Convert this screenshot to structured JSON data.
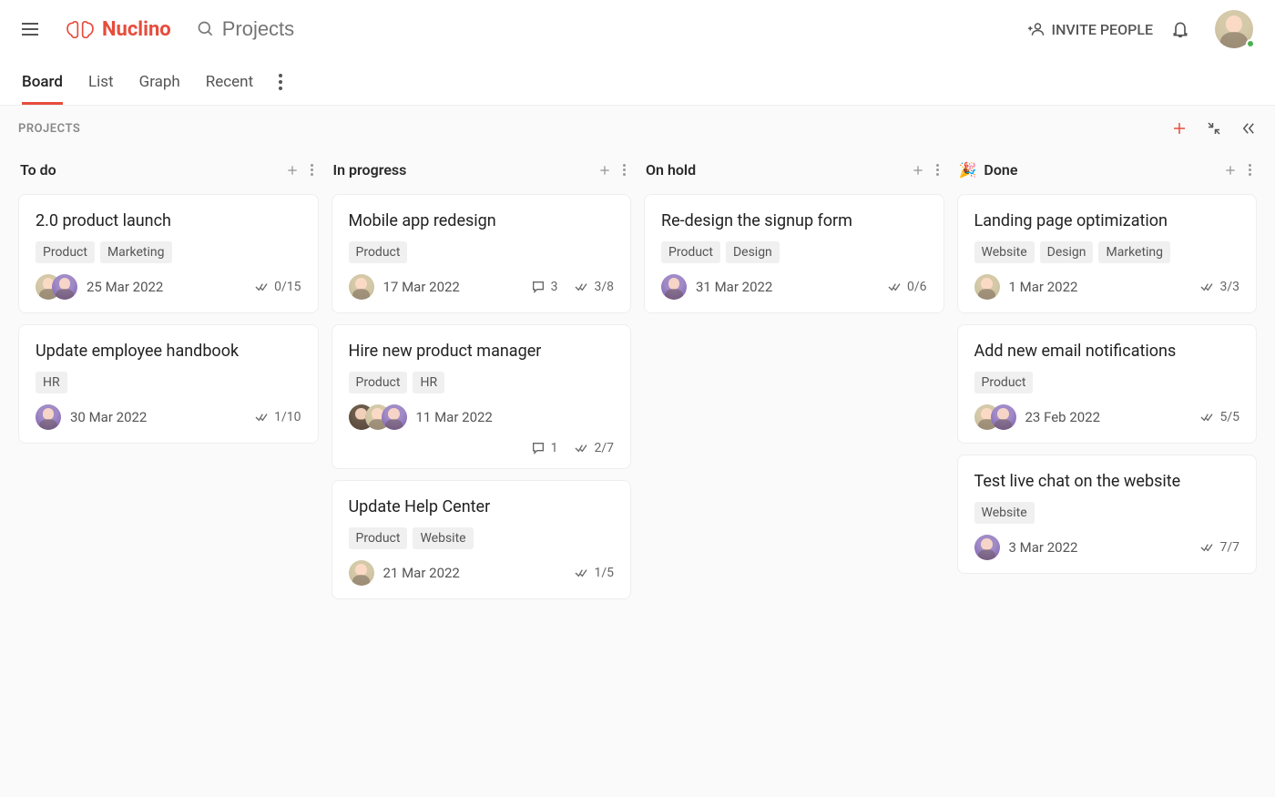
{
  "header": {
    "brand": "Nuclino",
    "search_placeholder": "Projects",
    "invite_label": "INVITE PEOPLE"
  },
  "tabs": {
    "board": "Board",
    "list": "List",
    "graph": "Graph",
    "recent": "Recent"
  },
  "crumb": "PROJECTS",
  "columns": [
    {
      "title": "To do",
      "emoji": "",
      "cards": [
        {
          "title": "2.0 product launch",
          "tags": [
            "Product",
            "Marketing"
          ],
          "avatars": [
            "beige",
            "purple"
          ],
          "date": "25 Mar 2022",
          "comments": null,
          "check": "0/15"
        },
        {
          "title": "Update employee handbook",
          "tags": [
            "HR"
          ],
          "avatars": [
            "purple"
          ],
          "date": "30 Mar 2022",
          "comments": null,
          "check": "1/10"
        }
      ]
    },
    {
      "title": "In progress",
      "emoji": "",
      "cards": [
        {
          "title": "Mobile app redesign",
          "tags": [
            "Product"
          ],
          "avatars": [
            "beige"
          ],
          "date": "17 Mar 2022",
          "comments": "3",
          "check": "3/8"
        },
        {
          "title": "Hire new product manager",
          "tags": [
            "Product",
            "HR"
          ],
          "avatars": [
            "dark",
            "beige",
            "purple"
          ],
          "date": "11 Mar 2022",
          "comments": "1",
          "check": "2/7"
        },
        {
          "title": "Update Help Center",
          "tags": [
            "Product",
            "Website"
          ],
          "avatars": [
            "beige"
          ],
          "date": "21 Mar 2022",
          "comments": null,
          "check": "1/5"
        }
      ]
    },
    {
      "title": "On hold",
      "emoji": "",
      "cards": [
        {
          "title": "Re-design the signup form",
          "tags": [
            "Product",
            "Design"
          ],
          "avatars": [
            "purple"
          ],
          "date": "31 Mar 2022",
          "comments": null,
          "check": "0/6"
        }
      ]
    },
    {
      "title": "Done",
      "emoji": "🎉",
      "cards": [
        {
          "title": "Landing page optimization",
          "tags": [
            "Website",
            "Design",
            "Marketing"
          ],
          "avatars": [
            "beige"
          ],
          "date": "1 Mar 2022",
          "comments": null,
          "check": "3/3"
        },
        {
          "title": "Add new email notifications",
          "tags": [
            "Product"
          ],
          "avatars": [
            "beige",
            "purple"
          ],
          "date": "23 Feb 2022",
          "comments": null,
          "check": "5/5"
        },
        {
          "title": "Test live chat on the website",
          "tags": [
            "Website"
          ],
          "avatars": [
            "purple"
          ],
          "date": "3 Mar 2022",
          "comments": null,
          "check": "7/7"
        }
      ]
    }
  ]
}
